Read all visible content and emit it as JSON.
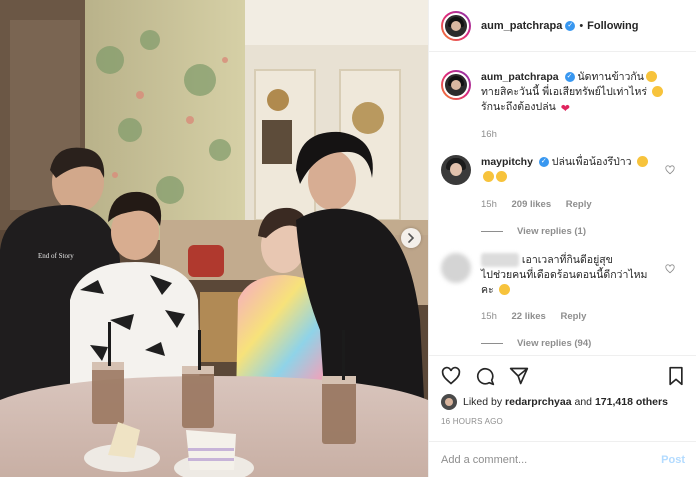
{
  "post": {
    "username": "aum_patchrapa",
    "follow_dot": "•",
    "follow_label": "Following",
    "caption_line1": "นัดทานข้าวกัน",
    "caption_line2": "ทายสิคะวันนี้ พี่เอเสียทรัพย์ไปเท่าไหร่",
    "caption_line3": "รักนะถึงต้องปล่น",
    "caption_time": "16h"
  },
  "comments": [
    {
      "username": "maypitchy",
      "text": "ปล่นเพื่อน้องรึป่าว",
      "time": "15h",
      "likes": "209 likes",
      "reply": "Reply",
      "view_replies": "View replies (1)"
    },
    {
      "username": "",
      "text_line1": "เอาเวลาที่กินดีอยู่สุข",
      "text_line2": "ไปช่วยคนที่เดือดร้อนตอนนี้ดีกว่าไหม",
      "text_line3": "คะ",
      "time": "15h",
      "likes": "22 likes",
      "reply": "Reply",
      "view_replies": "View replies (94)"
    }
  ],
  "likes_summary": {
    "prefix": "Liked by",
    "user": "redarprchyaa",
    "connector": "and",
    "count": "171,418 others"
  },
  "timestamp": "16 HOURS AGO",
  "composer": {
    "placeholder": "Add a comment...",
    "post_label": "Post"
  },
  "photo": {
    "shirt_text": "End of Story"
  },
  "icons": {
    "like": "heart-icon",
    "comment": "comment-icon",
    "share": "share-icon",
    "save": "bookmark-icon",
    "verified": "verified-badge-icon",
    "next": "chevron-right-icon"
  },
  "colors": {
    "verified": "#3897f0",
    "heart": "#e0245e",
    "post_disabled": "#b3dbff",
    "muted": "#8e8e8e"
  }
}
